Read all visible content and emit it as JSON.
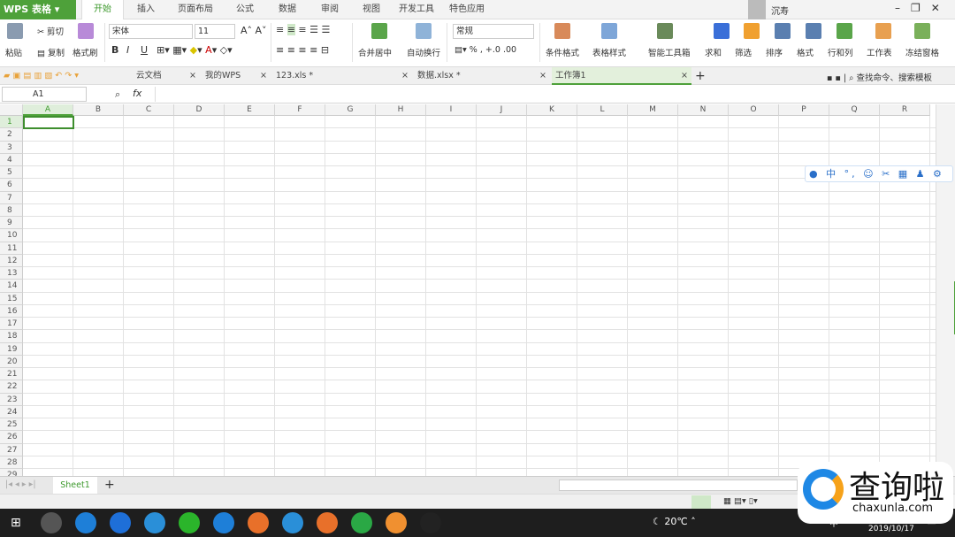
{
  "app": {
    "name": "WPS 表格",
    "user": "沉寿"
  },
  "menu_tabs": [
    "开始",
    "插入",
    "页面布局",
    "公式",
    "数据",
    "审阅",
    "视图",
    "开发工具",
    "特色应用"
  ],
  "active_menu": "开始",
  "ribbon": {
    "paste": "粘贴",
    "cut": "剪切",
    "copy": "复制",
    "format_painter": "格式刷",
    "font": "宋体",
    "font_size": "11",
    "bold": "B",
    "italic": "I",
    "underline": "U",
    "merge": "合并居中",
    "wrap": "自动换行",
    "number_format": "常规",
    "percent": "%",
    "comma": ",",
    "inc_dec": "+.0",
    "dec_dec": ".00",
    "cond_format": "条件格式",
    "table_style": "表格样式",
    "smart_toolbox": "智能工具箱",
    "sum": "求和",
    "filter": "筛选",
    "sort": "排序",
    "format": "格式",
    "rowcol": "行和列",
    "worksheet": "工作表",
    "freeze": "冻结窗格"
  },
  "doc_tabs": [
    {
      "label": "云文档"
    },
    {
      "label": "我的WPS"
    },
    {
      "label": "123.xls *"
    },
    {
      "label": "数据.xlsx *"
    },
    {
      "label": "工作簿1",
      "active": true
    }
  ],
  "search_label": "查找命令、搜索模板",
  "formula_bar": {
    "cell_ref": "A1",
    "fx": "fx",
    "value": ""
  },
  "columns": [
    "A",
    "B",
    "C",
    "D",
    "E",
    "F",
    "G",
    "H",
    "I",
    "J",
    "K",
    "L",
    "M",
    "N",
    "O",
    "P",
    "Q",
    "R"
  ],
  "rows": 29,
  "selected_cell": "A1",
  "sheets": [
    "Sheet1"
  ],
  "float_toolbar": "中 °,",
  "taskbar": {
    "weather": "20℃",
    "ime": "中",
    "date": "2019/10/17"
  },
  "watermark": {
    "brand": "查询啦",
    "url": "chaxunla.com"
  },
  "colors": {
    "accent": "#4ea13a",
    "taskbar": "#1e1e1e"
  }
}
